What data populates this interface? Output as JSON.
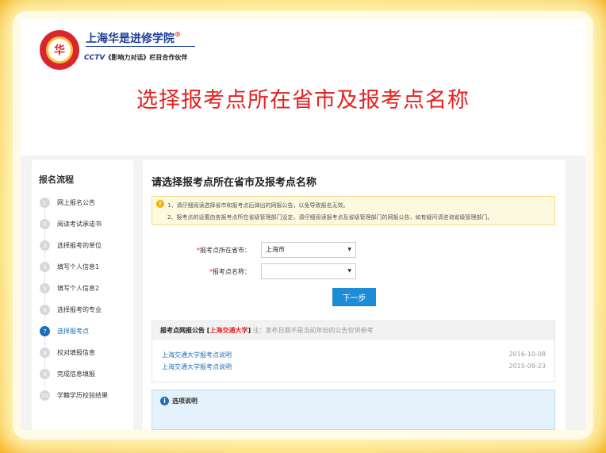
{
  "header": {
    "logo_mark": "华",
    "logo_name": "上海华是进修学院",
    "logo_reg": "®",
    "logo_tagline_cctv": "CCTV",
    "logo_tagline_rest": "《影响力对话》栏目合作伙伴"
  },
  "headline": "选择报考点所在省市及报考点名称",
  "sidebar": {
    "title": "报名流程",
    "items": [
      {
        "num": "1",
        "label": "网上报名公告"
      },
      {
        "num": "2",
        "label": "阅读考试承诺书"
      },
      {
        "num": "3",
        "label": "选择报考的单位"
      },
      {
        "num": "4",
        "label": "填写个人信息1"
      },
      {
        "num": "5",
        "label": "填写个人信息2"
      },
      {
        "num": "6",
        "label": "选择报考的专业"
      },
      {
        "num": "7",
        "label": "选择报考点"
      },
      {
        "num": "8",
        "label": "校对填报信息"
      },
      {
        "num": "9",
        "label": "完成信息填报"
      },
      {
        "num": "10",
        "label": "学籍学历校验结果"
      }
    ],
    "active_index": 6
  },
  "main": {
    "title": "请选择报考点所在省市及报考点名称",
    "notice": {
      "icon": "!",
      "line1": "1、请仔细阅读选择省市和报考点后弹出的网报公告，以免导致报名无效。",
      "line2": "2、报考点的设置由各报考点所在省级管理部门设定，请仔细阅读报考点及省级管理部门的网报公告，如有疑问请咨询省级管理部门。"
    },
    "form": {
      "province_req": "*",
      "province_label": "报考点所在省市：",
      "province_value": "上海市",
      "site_req": "*",
      "site_label": "报考点名称：",
      "site_value": "",
      "caret": "▼"
    },
    "next_button": "下一步",
    "announcement": {
      "head_prefix": "报考点网报公告 [",
      "school": "上海交通大学",
      "head_suffix": "]",
      "note": "注：发布日期不是当前年份的公告仅供参考",
      "items": [
        {
          "title": "上海交通大学报考点说明",
          "date": "2016-10-08"
        },
        {
          "title": "上海交通大学报考点说明",
          "date": "2015-09-23"
        }
      ]
    },
    "info": {
      "icon": "i",
      "title": "选项说明"
    }
  }
}
